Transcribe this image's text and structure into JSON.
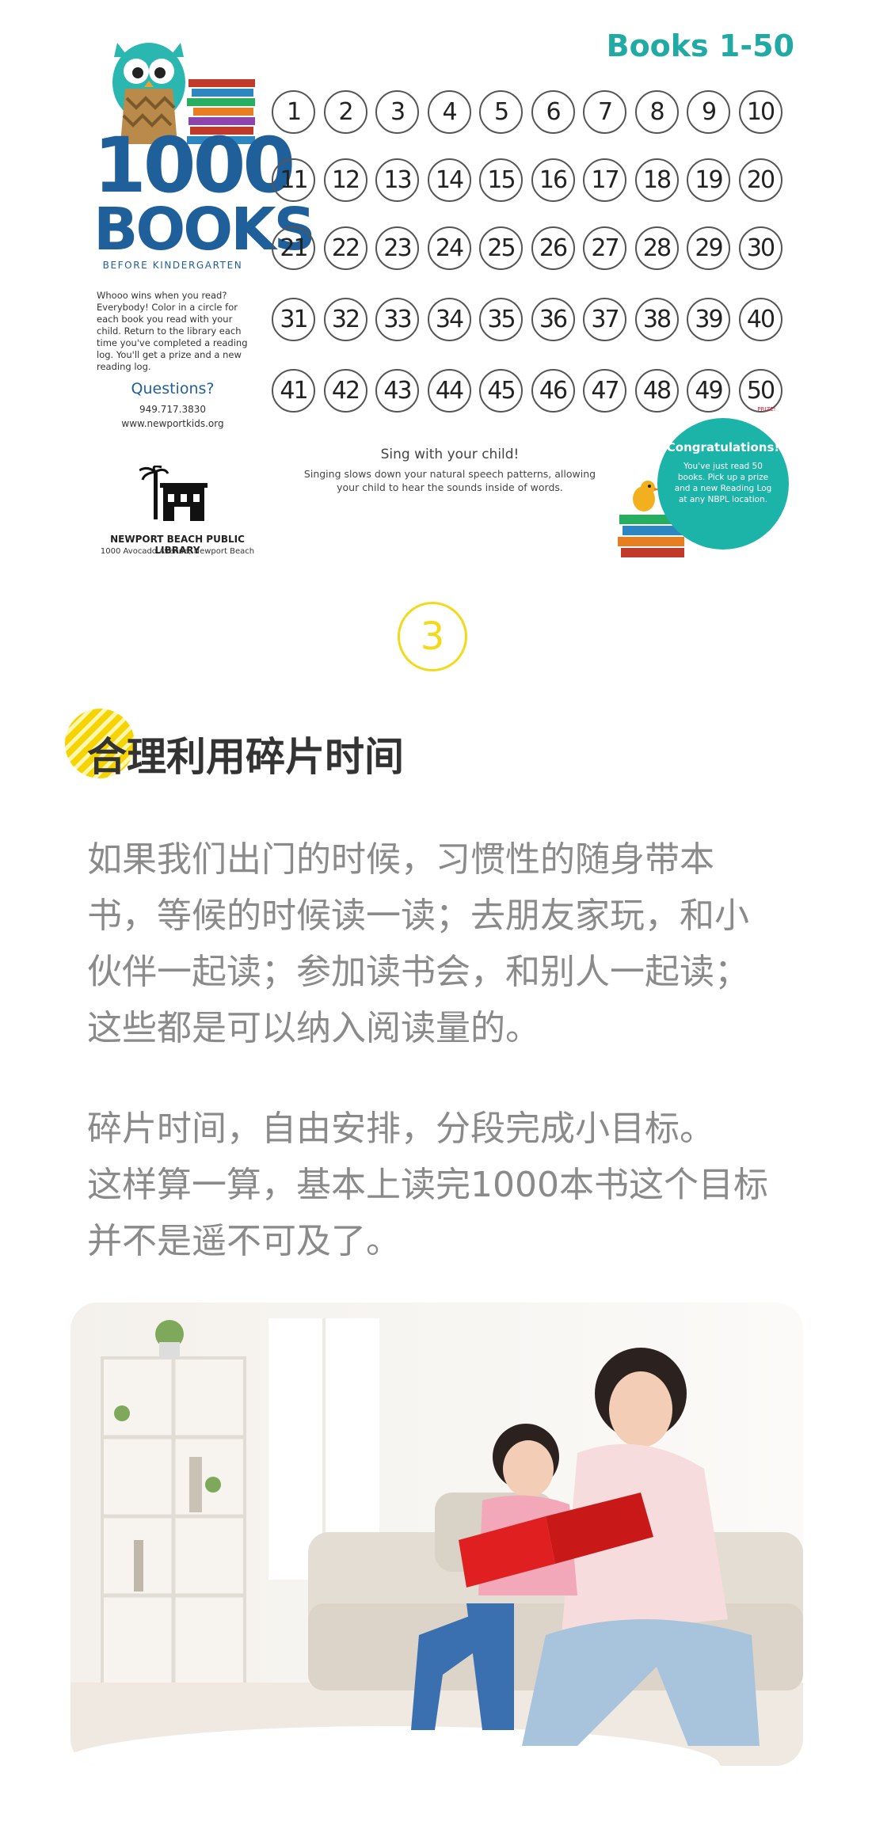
{
  "reading_log": {
    "brand_1000": "1000",
    "brand_books": "BOOKS",
    "brand_sub": "BEFORE KINDERGARTEN",
    "blurb": "Whooo wins when you read? Everybody! Color in a circle for each book you read with your child. Return to the library each time you've completed a reading log. You'll get a prize and a new reading log.",
    "questions_label": "Questions?",
    "phone": "949.717.3830",
    "website": "www.newportkids.org",
    "library_name": "NEWPORT BEACH PUBLIC LIBRARY",
    "library_address": "1000 Avocado Avenue, Newport Beach",
    "books_title": "Books 1-50",
    "book_numbers": [
      1,
      2,
      3,
      4,
      5,
      6,
      7,
      8,
      9,
      10,
      11,
      12,
      13,
      14,
      15,
      16,
      17,
      18,
      19,
      20,
      21,
      22,
      23,
      24,
      25,
      26,
      27,
      28,
      29,
      30,
      31,
      32,
      33,
      34,
      35,
      36,
      37,
      38,
      39,
      40,
      41,
      42,
      43,
      44,
      45,
      46,
      47,
      48,
      49,
      50
    ],
    "prize_tag": "PRIZE!",
    "sing_title": "Sing with your child!",
    "sing_body": "Singing slows down your natural speech patterns, allowing your child to hear the sounds inside of words.",
    "congrats_title": "Congratulations!",
    "congrats_body": "You've just read 50 books. Pick up a prize and a new Reading Log at any NBPL location.",
    "colors": {
      "brand_blue": "#1f5f9a",
      "teal": "#20aaa3"
    }
  },
  "section": {
    "number": "3",
    "number_color": "#f2da1a",
    "heading": "合理利用碎片时间"
  },
  "paragraph1": [
    "如果我们出门的时候，习惯性的随身带本",
    "书，等候的时候读一读；去朋友家玩，和小",
    "伙伴一起读；参加读书会，和别人一起读；",
    "这些都是可以纳入阅读量的。"
  ],
  "paragraph2": [
    "碎片时间，自由安排，分段完成小目标。",
    "这样算一算，基本上读完1000本书这个目标",
    "并不是遥不可及了。"
  ],
  "photo": {
    "icon": "mother-daughter-reading-photo"
  }
}
